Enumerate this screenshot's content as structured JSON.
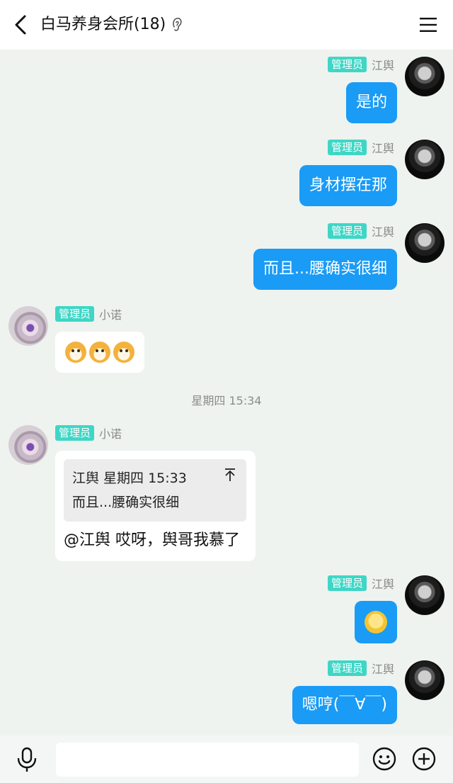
{
  "header": {
    "title": "白马养身会所(18)"
  },
  "messages": [
    {
      "badge": "管理员",
      "sender": "江舆",
      "text": "是的"
    },
    {
      "badge": "管理员",
      "sender": "江舆",
      "text": "身材摆在那"
    },
    {
      "badge": "管理员",
      "sender": "江舆",
      "text": "而且...腰确实很细"
    },
    {
      "badge": "管理员",
      "sender": "小诺",
      "emoji": [
        "dog-emoji",
        "dog-emoji",
        "dog-emoji"
      ]
    },
    {
      "badge": "管理员",
      "sender": "小诺",
      "quote_header": "江舆 星期四 15:33",
      "quote_text": "而且...腰确实很细",
      "text": "@江舆 哎呀，舆哥我慕了"
    },
    {
      "badge": "管理员",
      "sender": "江舆",
      "sticker": "chick-sticker"
    },
    {
      "badge": "管理员",
      "sender": "江舆",
      "text": "嗯哼(￣∀￣)"
    }
  ],
  "timestamp": "星期四 15:34",
  "input": {
    "placeholder": ""
  },
  "colors": {
    "accent": "#1a9bf5",
    "badge": "#3fd6c6",
    "background": "#eef3ef"
  }
}
